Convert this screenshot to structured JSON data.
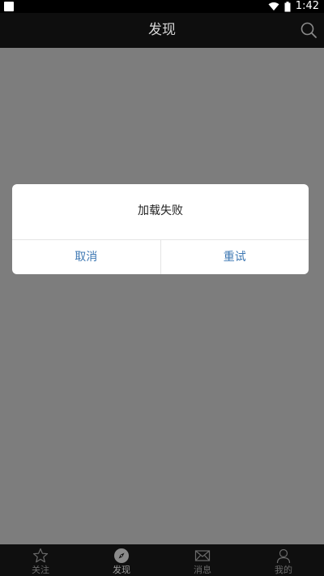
{
  "status_bar": {
    "time": "1:42"
  },
  "app_bar": {
    "title": "发现"
  },
  "dialog": {
    "message": "加载失败",
    "cancel_label": "取消",
    "retry_label": "重试"
  },
  "tabs": [
    {
      "label": "关注",
      "icon": "star-icon"
    },
    {
      "label": "发现",
      "icon": "compass-icon",
      "active": true
    },
    {
      "label": "消息",
      "icon": "mail-icon"
    },
    {
      "label": "我的",
      "icon": "person-icon"
    }
  ],
  "colors": {
    "overlay": "#7d7d7d",
    "app_bar": "#0e0e0e",
    "accent": "#3e78b3"
  }
}
